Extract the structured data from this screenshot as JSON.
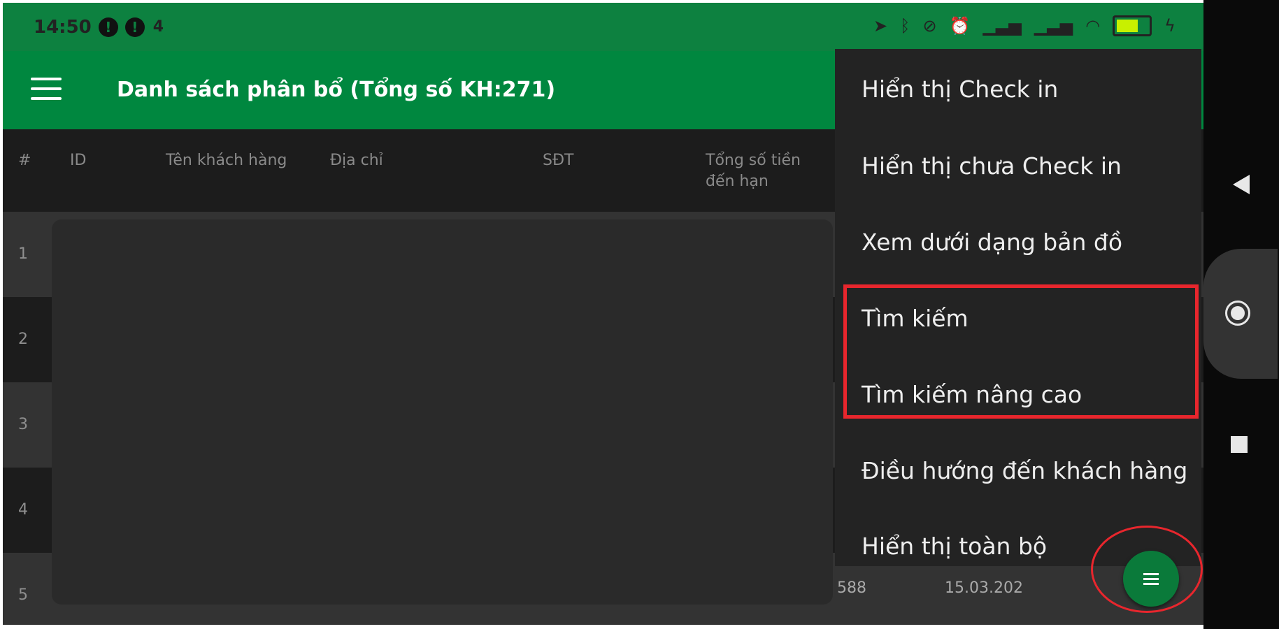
{
  "status_bar": {
    "time": "14:50",
    "badge_1": "!",
    "badge_2": "!",
    "extra_icon": "4"
  },
  "app_bar": {
    "title": "Danh sách phân bổ (Tổng số KH:271)"
  },
  "table": {
    "headers": [
      "#",
      "ID",
      "Tên khách hàng",
      "Địa chỉ",
      "SĐT",
      "Tổng số tiền đến hạn"
    ],
    "rows": [
      {
        "num": "1"
      },
      {
        "num": "2"
      },
      {
        "num": "3"
      },
      {
        "num": "4"
      },
      {
        "num": "5",
        "amount": "588",
        "date": "15.03.202"
      }
    ]
  },
  "menu": {
    "items": [
      "Hiển thị Check in",
      "Hiển thị chưa Check in",
      "Xem dưới dạng bản đồ",
      "Tìm kiếm",
      "Tìm kiếm nâng cao",
      "Điều hướng đến khách hàng",
      "Hiển thị toàn bộ"
    ]
  },
  "colors": {
    "status_bar": "#0d8140",
    "app_bar": "#00873f",
    "highlight": "#e8262d",
    "fab": "#0a7a3a"
  },
  "icons": {
    "menu": "hamburger-icon",
    "back": "back-triangle-icon",
    "home": "home-circle-icon",
    "recent": "recent-square-icon",
    "fab": "list-icon"
  }
}
